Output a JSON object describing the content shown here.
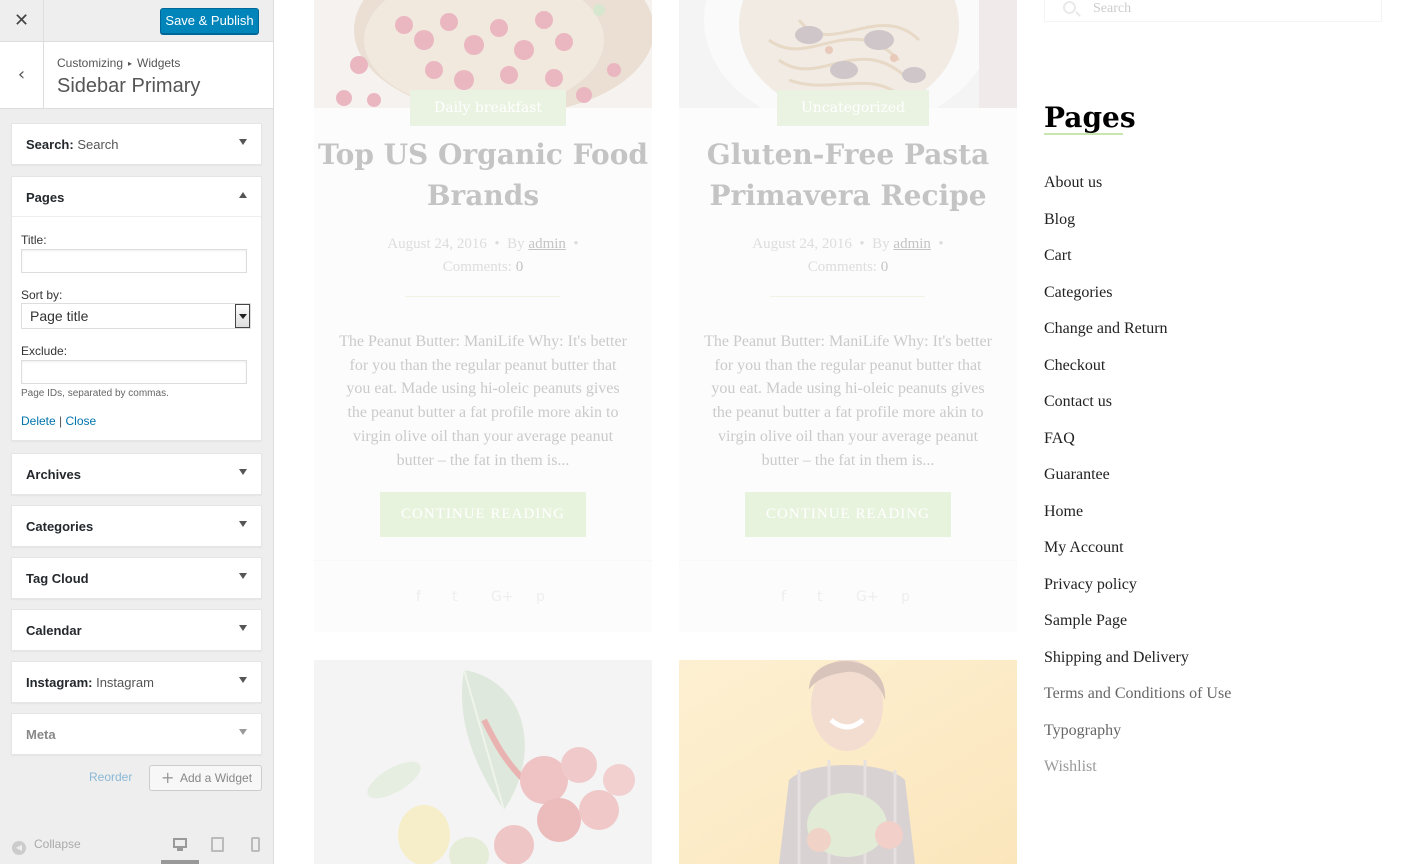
{
  "header": {
    "close_symbol": "✕",
    "save_label": "Save & Publish"
  },
  "breadcrumb": {
    "parent": "Customizing",
    "child": "Widgets",
    "separator": "▸",
    "title": "Sidebar Primary"
  },
  "widgets": {
    "search": {
      "name": "Search:",
      "instance": "Search"
    },
    "pages": {
      "name": "Pages",
      "title_label": "Title:",
      "title_value": "",
      "sort_label": "Sort by:",
      "sort_value": "Page title",
      "exclude_label": "Exclude:",
      "exclude_value": "",
      "exclude_desc": "Page IDs, separated by commas.",
      "delete_label": "Delete",
      "link_sep": "|",
      "close_label": "Close"
    },
    "archives": {
      "name": "Archives"
    },
    "categories": {
      "name": "Categories"
    },
    "tag_cloud": {
      "name": "Tag Cloud"
    },
    "calendar": {
      "name": "Calendar"
    },
    "instagram": {
      "name": "Instagram:",
      "instance": "Instagram"
    },
    "meta": {
      "name": "Meta"
    }
  },
  "actions": {
    "reorder_label": "Reorder",
    "add_label": "Add a Widget"
  },
  "footer": {
    "collapse_label": "Collapse"
  },
  "preview": {
    "posts": [
      {
        "category": "Daily breakfast",
        "title": "Top US Organic Food Brands",
        "date": "August 24, 2016",
        "by": "By",
        "author": "admin",
        "comments_label": "Comments:",
        "comments": "0",
        "excerpt": "The Peanut Butter: ManiLife Why: It's better for you than the regular peanut butter that you eat. Made using hi-oleic peanuts gives the peanut butter a fat profile more akin to virgin olive oil than your average peanut butter – the fat in them is...",
        "button": "CONTINUE READING"
      },
      {
        "category": "Uncategorized",
        "title": "Gluten-Free Pasta Primavera Recipe",
        "date": "August 24, 2016",
        "by": "By",
        "author": "admin",
        "comments_label": "Comments:",
        "comments": "0",
        "excerpt": "The Peanut Butter: ManiLife Why: It's better for you than the regular peanut butter that you eat. Made using hi-oleic peanuts gives the peanut butter a fat profile more akin to virgin olive oil than your average peanut butter – the fat in them is...",
        "button": "CONTINUE READING"
      }
    ],
    "sidebar": {
      "search_placeholder": "Search",
      "pages_heading": "Pages",
      "pages": [
        "About us",
        "Blog",
        "Cart",
        "Categories",
        "Change and Return",
        "Checkout",
        "Contact us",
        "FAQ",
        "Guarantee",
        "Home",
        "My Account",
        "Privacy policy",
        "Sample Page",
        "Shipping and Delivery",
        "Terms and Conditions of Use",
        "Typography",
        "Wishlist"
      ]
    }
  },
  "colors": {
    "accent": "#0085ba",
    "link": "#0073aa",
    "badge": "#eaf3e2"
  }
}
